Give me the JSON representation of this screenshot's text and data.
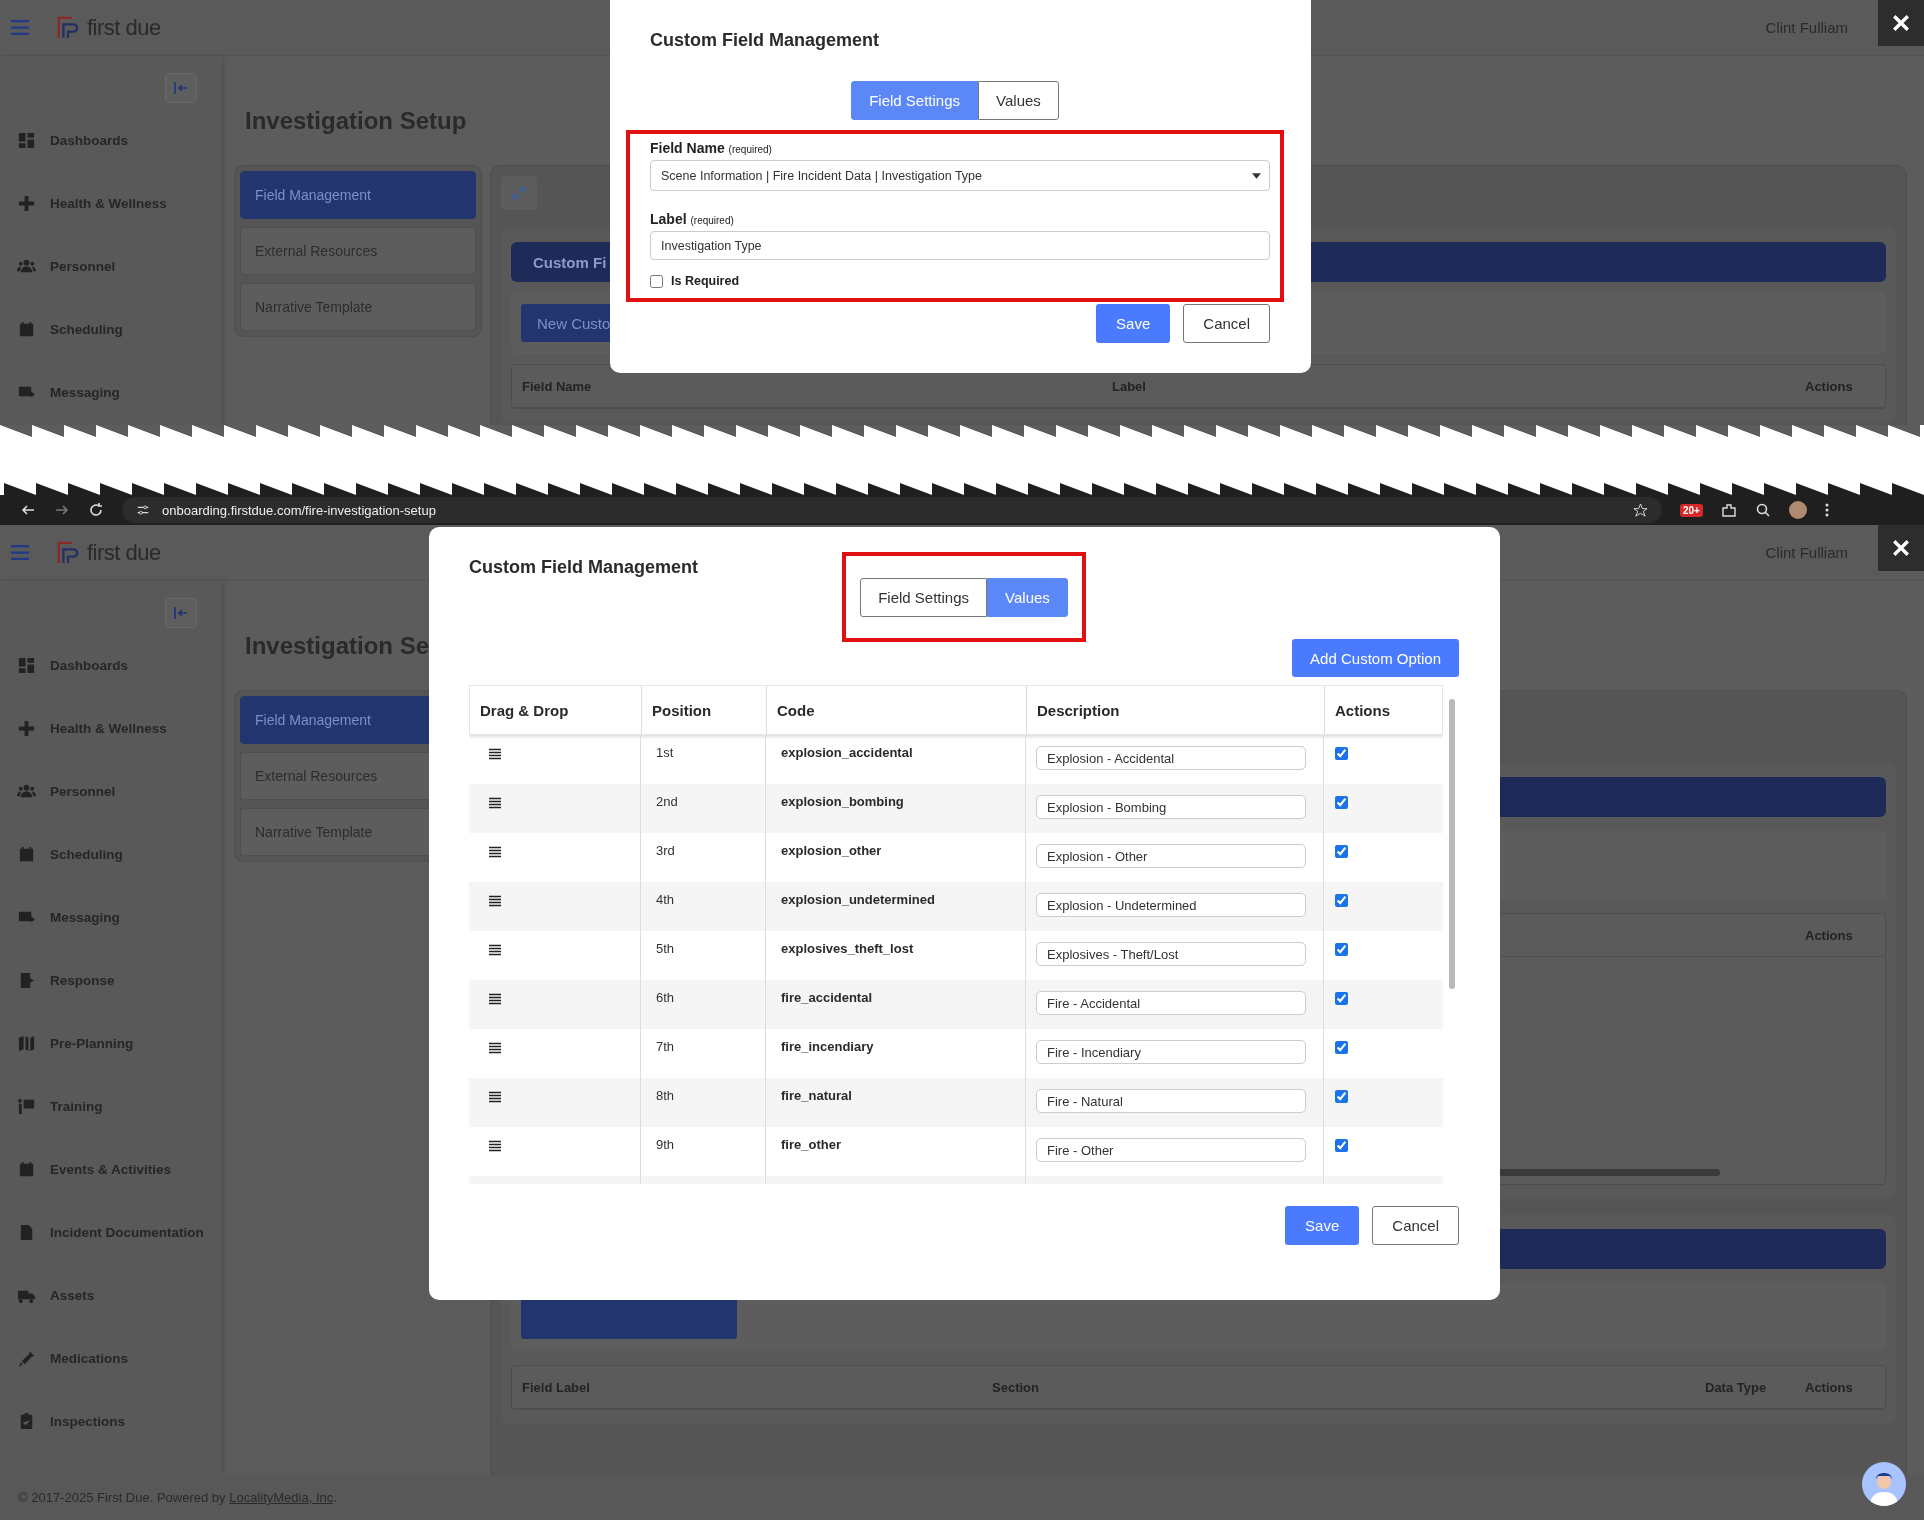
{
  "top_screenshot": {
    "header": {
      "logo": "first due",
      "user": "Clint Fulliam"
    },
    "sidebar": {
      "items": [
        "Dashboards",
        "Health & Wellness",
        "Personnel",
        "Scheduling",
        "Messaging"
      ]
    },
    "page_title": "Investigation Setup",
    "setup_nav": [
      {
        "label": "Field Management",
        "selected": true
      },
      {
        "label": "External Resources",
        "selected": false
      },
      {
        "label": "Narrative Template",
        "selected": false
      }
    ],
    "section_bar": "Custom Fi",
    "new_button": "New Custo",
    "table_columns": [
      "Field Name",
      "Label",
      "Actions"
    ],
    "modal": {
      "title": "Custom Field Management",
      "tabs": [
        {
          "label": "Field Settings",
          "selected": true
        },
        {
          "label": "Values",
          "selected": false
        }
      ],
      "field_name": {
        "label": "Field Name",
        "hint": "(required)",
        "value": "Scene Information | Fire Incident Data | Investigation Type"
      },
      "label_field": {
        "label": "Label",
        "hint": "(required)",
        "value": "Investigation Type"
      },
      "is_required": {
        "label": "Is Required",
        "checked": false
      },
      "buttons": [
        "Save",
        "Cancel"
      ]
    }
  },
  "browser_bar": {
    "url": "onboarding.firstdue.com/fire-investigation-setup",
    "badge": "20+"
  },
  "bottom_screenshot": {
    "header": {
      "logo": "first due",
      "user": "Clint Fulliam"
    },
    "sidebar": {
      "items": [
        "Dashboards",
        "Health & Wellness",
        "Personnel",
        "Scheduling",
        "Messaging",
        "Response",
        "Pre-Planning",
        "Training",
        "Events & Activities",
        "Incident Documentation",
        "Assets",
        "Medications",
        "Inspections"
      ]
    },
    "page_title": "Investigation Se",
    "setup_nav": [
      {
        "label": "Field Management",
        "selected": true
      },
      {
        "label": "External Resources",
        "selected": false
      },
      {
        "label": "Narrative Template",
        "selected": false
      }
    ],
    "upper_table_columns": [
      "Actions"
    ],
    "table_columns": [
      "Field Label",
      "Section",
      "Data Type",
      "Actions"
    ],
    "footer": {
      "text": "© 2017-2025 First Due. Powered by",
      "link": "LocalityMedia, Inc",
      "end": "."
    },
    "modal": {
      "title": "Custom Field Management",
      "tabs": [
        {
          "label": "Field Settings",
          "selected": false
        },
        {
          "label": "Values",
          "selected": true
        }
      ],
      "add_button": "Add Custom Option",
      "columns": [
        "Drag & Drop",
        "Position",
        "Code",
        "Description",
        "Actions"
      ],
      "rows": [
        {
          "position": "1st",
          "code": "explosion_accidental",
          "description": "Explosion - Accidental",
          "checked": true
        },
        {
          "position": "2nd",
          "code": "explosion_bombing",
          "description": "Explosion - Bombing",
          "checked": true
        },
        {
          "position": "3rd",
          "code": "explosion_other",
          "description": "Explosion - Other",
          "checked": true
        },
        {
          "position": "4th",
          "code": "explosion_undetermined",
          "description": "Explosion - Undetermined",
          "checked": true
        },
        {
          "position": "5th",
          "code": "explosives_theft_lost",
          "description": "Explosives - Theft/Lost",
          "checked": true
        },
        {
          "position": "6th",
          "code": "fire_accidental",
          "description": "Fire - Accidental",
          "checked": true
        },
        {
          "position": "7th",
          "code": "fire_incendiary",
          "description": "Fire - Incendiary",
          "checked": true
        },
        {
          "position": "8th",
          "code": "fire_natural",
          "description": "Fire - Natural",
          "checked": true
        },
        {
          "position": "9th",
          "code": "fire_other",
          "description": "Fire - Other",
          "checked": true
        }
      ],
      "buttons": [
        "Save",
        "Cancel"
      ]
    }
  }
}
